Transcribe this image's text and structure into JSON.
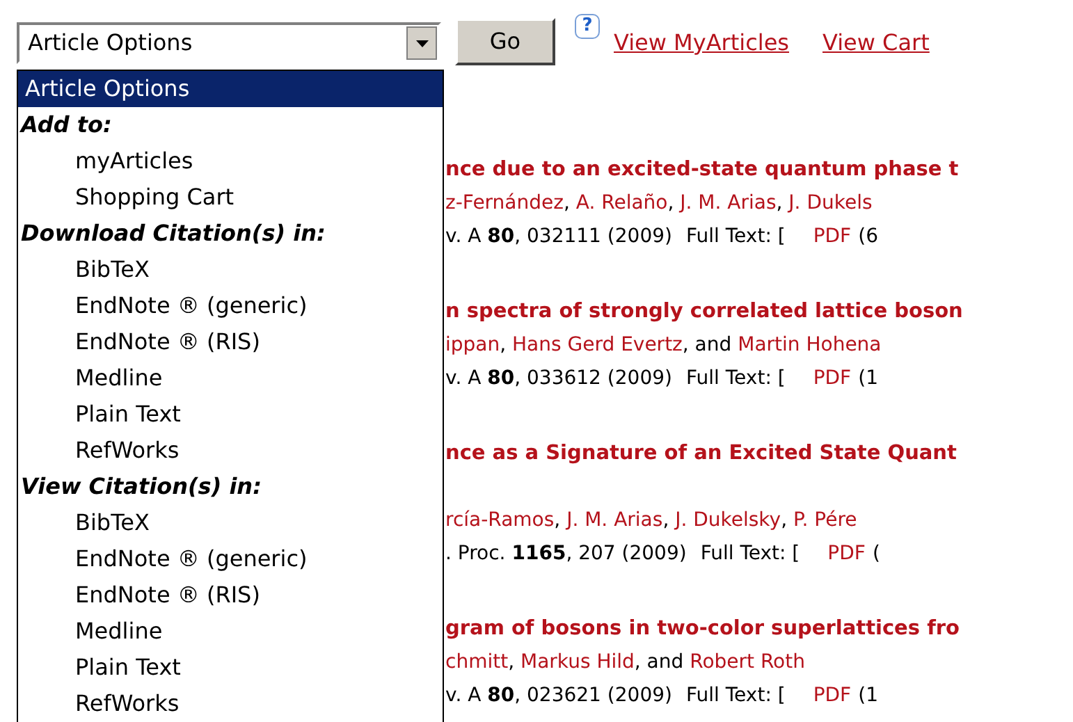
{
  "toolbar": {
    "select": {
      "value": "Article Options",
      "expanded": true
    },
    "go_button": "Go",
    "help_icon": "?",
    "links": [
      "View MyArticles",
      "View Cart"
    ]
  },
  "listbox": {
    "items": [
      {
        "kind": "option",
        "label": "Article Options",
        "selected": true
      },
      {
        "kind": "group",
        "label": "Add to:",
        "children": [
          {
            "label": "myArticles",
            "selected": false
          },
          {
            "label": "Shopping Cart",
            "selected": false
          }
        ]
      },
      {
        "kind": "group",
        "label": "Download Citation(s) in:",
        "children": [
          {
            "label": "BibTeX",
            "selected": false
          },
          {
            "label": "EndNote ® (generic)",
            "selected": false
          },
          {
            "label": "EndNote ® (RIS)",
            "selected": false
          },
          {
            "label": "Medline",
            "selected": false
          },
          {
            "label": "Plain Text",
            "selected": false
          },
          {
            "label": "RefWorks",
            "selected": false
          }
        ]
      },
      {
        "kind": "group",
        "label": "View Citation(s) in:",
        "children": [
          {
            "label": "BibTeX",
            "selected": false
          },
          {
            "label": "EndNote ® (generic)",
            "selected": false
          },
          {
            "label": "EndNote ® (RIS)",
            "selected": false
          },
          {
            "label": "Medline",
            "selected": false
          },
          {
            "label": "Plain Text",
            "selected": false
          },
          {
            "label": "RefWorks",
            "selected": false
          }
        ]
      }
    ]
  },
  "articles": [
    {
      "title": "nce due to an excited-state quantum phase t",
      "authors": [
        {
          "name": "z-Fernández",
          "after": ", "
        },
        {
          "name": "A. Relaño",
          "after": ", "
        },
        {
          "name": "J. M. Arias",
          "after": ", "
        },
        {
          "name": "J. Dukels"
        }
      ],
      "citation": "v. A **80**, 032111 (2009)",
      "full_text_label": "Full Text: [",
      "pdf_link": "PDF",
      "pdf_size": "(6"
    },
    {
      "title": "n spectra of strongly correlated lattice boson",
      "authors": [
        {
          "name": "ippan",
          "after": ", "
        },
        {
          "name": "Hans Gerd Evertz",
          "after": ", and "
        },
        {
          "name": "Martin Hohena"
        }
      ],
      "citation": "v. A **80**, 033612 (2009)",
      "full_text_label": "Full Text: [",
      "pdf_link": "PDF",
      "pdf_size": "(1"
    },
    {
      "title": "nce as a Signature of an Excited State Quant",
      "authors": [
        {
          "name": "rcía-Ramos",
          "after": ", "
        },
        {
          "name": "J. M. Arias",
          "after": ", "
        },
        {
          "name": "J. Dukelsky",
          "after": ", "
        },
        {
          "name": "P. Pére"
        }
      ],
      "citation": ". Proc. **1165**, 207 (2009)",
      "full_text_label": "Full Text: [",
      "pdf_link": "PDF",
      "pdf_size": "("
    },
    {
      "title": "gram of bosons in two-color superlattices fro",
      "authors": [
        {
          "name": "chmitt",
          "after": ", "
        },
        {
          "name": "Markus Hild",
          "after": ", and "
        },
        {
          "name": "Robert Roth"
        }
      ],
      "citation": "v. A **80**, 023621 (2009)",
      "full_text_label": "Full Text: [",
      "pdf_link": "PDF",
      "pdf_size": "(1"
    }
  ]
}
